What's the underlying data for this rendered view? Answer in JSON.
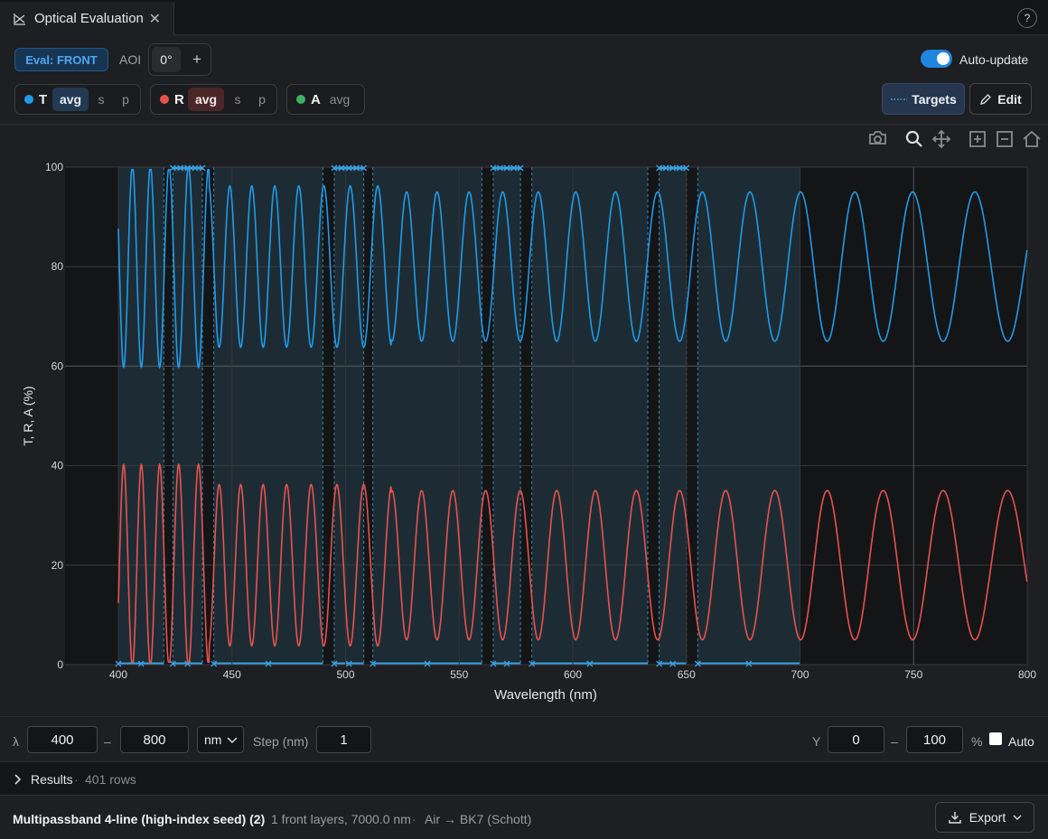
{
  "tab": {
    "title": "Optical Evaluation",
    "close": "✕",
    "help": "?"
  },
  "toolbar": {
    "eval_label": "Eval: FRONT",
    "aoi_label": "AOI",
    "aoi_value": "0°",
    "aoi_add": "+",
    "auto_update_label": "Auto-update",
    "auto_update_on": true,
    "targets_label": "Targets",
    "edit_label": "Edit"
  },
  "channels": [
    {
      "letter": "T",
      "color": "#1f9bea",
      "options": [
        "avg",
        "s",
        "p"
      ],
      "selected": "avg"
    },
    {
      "letter": "R",
      "color": "#e8524d",
      "options": [
        "avg",
        "s",
        "p"
      ],
      "selected": "avg"
    },
    {
      "letter": "A",
      "color": "#3fb163",
      "options": [
        "avg"
      ],
      "selected": ""
    }
  ],
  "chart_data": {
    "type": "line",
    "xlabel": "Wavelength (nm)",
    "ylabel": "T, R, A (%)",
    "xlim": [
      400,
      800
    ],
    "ylim": [
      0,
      100
    ],
    "xticks": [
      400,
      450,
      500,
      550,
      600,
      650,
      700,
      750,
      800
    ],
    "yticks": [
      0,
      20,
      40,
      60,
      80,
      100
    ],
    "grid": true,
    "series": [
      {
        "name": "T",
        "color": "#1f9bea",
        "baseline": 80,
        "amplitude": 15,
        "description_points": [
          [
            400,
            65
          ],
          [
            420,
            93
          ],
          [
            480,
            63
          ],
          [
            550,
            95
          ],
          [
            650,
            64
          ],
          [
            700,
            95
          ],
          [
            800,
            66
          ]
        ]
      },
      {
        "name": "R",
        "color": "#e8524d",
        "baseline": 20,
        "amplitude": 15,
        "description_points": [
          [
            400,
            8
          ],
          [
            420,
            36
          ],
          [
            480,
            5
          ],
          [
            550,
            37
          ],
          [
            650,
            5
          ],
          [
            700,
            5
          ],
          [
            800,
            34
          ]
        ]
      }
    ],
    "target_bands": [
      [
        400,
        420
      ],
      [
        424,
        437
      ],
      [
        442,
        490
      ],
      [
        495,
        508
      ],
      [
        512,
        560
      ],
      [
        565,
        577
      ],
      [
        582,
        633
      ],
      [
        638,
        650
      ],
      [
        655,
        700
      ]
    ],
    "target_markers_top": [
      [
        424,
        437
      ],
      [
        495,
        508
      ],
      [
        565,
        577
      ],
      [
        638,
        650
      ]
    ],
    "mode_bar_icons": [
      "camera-icon",
      "zoom-icon",
      "pan-icon",
      "zoom-in-icon",
      "zoom-out-icon",
      "home-icon"
    ]
  },
  "range": {
    "lambda_label": "λ",
    "from": "400",
    "dash": "–",
    "to": "800",
    "unit": "nm",
    "step_label": "Step (nm)",
    "step": "1",
    "y_label": "Y",
    "y_from": "0",
    "y_to": "100",
    "y_unit": "%",
    "auto_label": "Auto"
  },
  "results": {
    "label": "Results",
    "sep": "·",
    "rows": "401 rows"
  },
  "footer": {
    "design_name": "Multipassband 4-line (high-index seed) (2)",
    "sep": "·",
    "layers": "1 front layers, 7000.0 nm",
    "media": "Air → BK7 (Schott)",
    "export_label": "Export"
  }
}
